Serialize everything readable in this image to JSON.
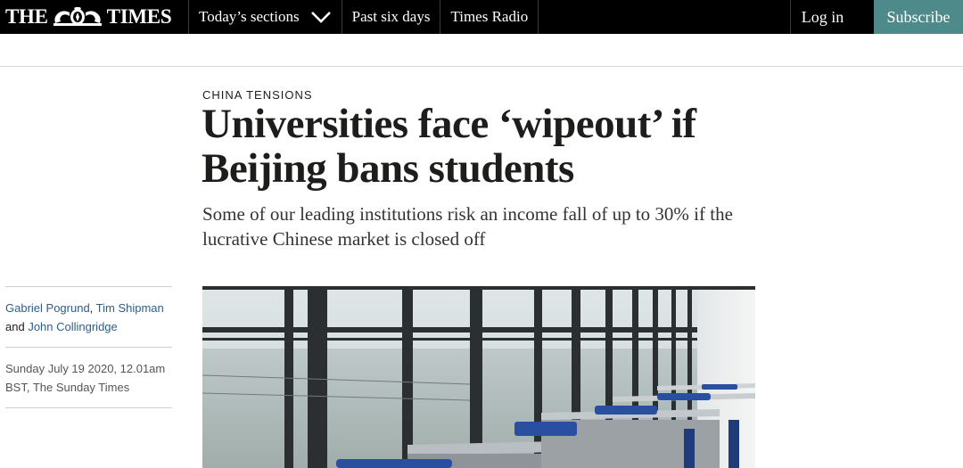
{
  "nav": {
    "logo_left": "THE",
    "logo_right": "TIMES",
    "crest_icon": "royal-crest-icon",
    "items": [
      {
        "label": "Today’s sections",
        "has_dropdown": true
      },
      {
        "label": "Past six days",
        "has_dropdown": false
      },
      {
        "label": "Times Radio",
        "has_dropdown": false
      }
    ],
    "login_label": "Log in",
    "subscribe_label": "Subscribe",
    "subscribe_color": "#4f8a8b"
  },
  "article": {
    "section": "CHINA TENSIONS",
    "headline": "Universities face ‘wipeout’ if Beijing bans students",
    "standfirst": "Some of our leading institutions risk an income fall of up to 30% if the lucrative Chinese market is closed off",
    "authors": {
      "first": "Gabriel Pogrund",
      "sep1": ", ",
      "second": "Tim Shipman",
      "and": " and ",
      "third": "John Collingridge"
    },
    "dateline": "Sunday July 19 2020, 12.01am BST, The Sunday Times",
    "image_alt_icon": "empty-classroom-photo"
  },
  "colors": {
    "topbar": "#000000",
    "author_link": "#2c5e8c",
    "text": "#1d1d1b"
  }
}
